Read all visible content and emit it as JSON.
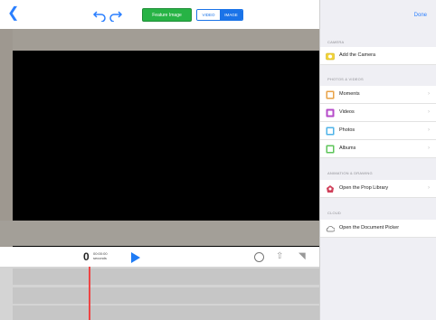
{
  "topbar": {
    "feature_image_label": "Feature Image",
    "segment": {
      "left": "VIDEO",
      "right": "IMAGE"
    }
  },
  "timecode": {
    "major": "0",
    "sub_top": "00:00:00",
    "sub_bottom": "seconds"
  },
  "panel": {
    "done": "Done",
    "sections": [
      {
        "title": "CAMERA",
        "items": [
          {
            "label": "Add the Camera",
            "icon": "camera-icon"
          }
        ]
      },
      {
        "title": "PHOTOS & VIDEOS",
        "items": [
          {
            "label": "Moments",
            "icon": "moments-icon"
          },
          {
            "label": "Videos",
            "icon": "videos-icon"
          },
          {
            "label": "Photos",
            "icon": "photos-icon"
          },
          {
            "label": "Albums",
            "icon": "albums-icon"
          }
        ]
      },
      {
        "title": "ANIMATION & DRAWING",
        "items": [
          {
            "label": "Open the Prop Library",
            "icon": "prop-library-icon"
          }
        ]
      },
      {
        "title": "CLOUD",
        "items": [
          {
            "label": "Open the Document Picker",
            "icon": "cloud-icon"
          }
        ]
      }
    ]
  },
  "colors": {
    "accent": "#1a73e8",
    "feature_green": "#27b345",
    "playhead": "#e44444",
    "panel_bg": "#efeff4"
  }
}
